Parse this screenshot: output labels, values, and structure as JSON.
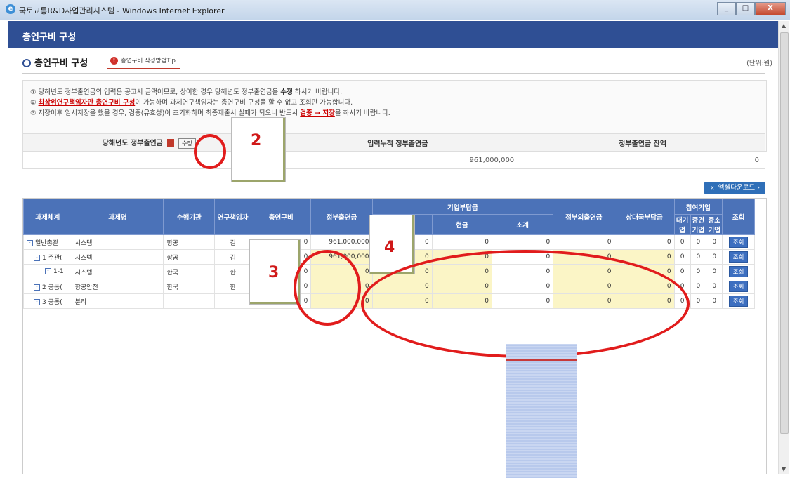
{
  "window": {
    "title": "국토교통R&D사업관리시스템 - Windows Internet Explorer",
    "min_label": "_",
    "max_label": "□",
    "close_label": "X"
  },
  "banner": {
    "title": "총연구비 구성"
  },
  "section": {
    "title": "총연구비 구성",
    "tip_label": "총연구비 작성방법Tip",
    "unit": "(단위:원)"
  },
  "notice": {
    "line1_pre": "① 당해년도 정부출연금의 입력은 공고시 금액이므로, 상이한 경우 당해년도 정부출연금을 ",
    "line1_bold": "수정",
    "line1_post": " 하시기 바랍니다.",
    "line2_pre": "② ",
    "line2_red": "최상위연구책임자만 총연구비 구성",
    "line2_post": "이 가능하며 과제연구책임자는 총연구비 구성을 할 수 없고 조회만 가능합니다.",
    "line3_pre": "③ 저장이후 임시저장을 했을 경우, 검증(유효성)이 초기화하며 최종제출시 실패가 되오니 반드시 ",
    "line3_red": "검증 → 저장",
    "line3_post": "을 하시기 바랍니다."
  },
  "summary": {
    "col1": "당해년도 정부출연금",
    "edit_label": "수정",
    "col2": "입력누적 정부출연금",
    "col3": "정부출연금 잔액",
    "val1": "0",
    "val2": "961,000,000",
    "val3": "0"
  },
  "excel_label": "엑셀다운로드 ›",
  "grid": {
    "headers": {
      "system": "과제체계",
      "name": "과제명",
      "org": "수행기관",
      "leader": "연구책임자",
      "total": "총연구비",
      "gov": "정부출연금",
      "company": "기업부담금",
      "cash": "현금",
      "subtotal": "소계",
      "nongov": "정부외출연금",
      "partner": "상대국부담금",
      "participating": "참여기업",
      "large": "대기업",
      "mid": "중견기업",
      "small": "중소기업",
      "view": "조회"
    },
    "rows": [
      {
        "sys": "일반총괄",
        "name": "시스템",
        "org": "항공",
        "leader": "김",
        "total": "0",
        "gov": "961,000,000",
        "inkind": "0",
        "cash": "0",
        "sub": "0",
        "nongov": "0",
        "partner": "0",
        "l": "0",
        "m": "0",
        "s": "0",
        "btn": "조회"
      },
      {
        "sys": "1 주관(",
        "name": "시스템",
        "org": "항공",
        "leader": "김",
        "total": "0",
        "gov": "961,000,000",
        "inkind": "0",
        "cash": "0",
        "sub": "0",
        "nongov": "0",
        "partner": "0",
        "l": "0",
        "m": "0",
        "s": "0",
        "btn": "조회"
      },
      {
        "sys": "1-1",
        "name": "시스템",
        "org": "한국",
        "leader": "한",
        "total": "0",
        "gov": "0",
        "inkind": "0",
        "cash": "0",
        "sub": "0",
        "nongov": "0",
        "partner": "0",
        "l": "0",
        "m": "0",
        "s": "0",
        "btn": "조회"
      },
      {
        "sys": "2 공동(",
        "name": "항공안전",
        "org": "한국",
        "leader": "한",
        "total": "0",
        "gov": "0",
        "inkind": "0",
        "cash": "0",
        "sub": "0",
        "nongov": "0",
        "partner": "0",
        "l": "0",
        "m": "0",
        "s": "0",
        "btn": "조회"
      },
      {
        "sys": "3 공동(",
        "name": "분리",
        "org": "",
        "leader": "",
        "total": "0",
        "gov": "0",
        "inkind": "0",
        "cash": "0",
        "sub": "0",
        "nongov": "0",
        "partner": "0",
        "l": "0",
        "m": "0",
        "s": "0",
        "btn": "조회"
      }
    ]
  },
  "annotations": {
    "n2": "2",
    "n3": "3",
    "n4": "4"
  }
}
